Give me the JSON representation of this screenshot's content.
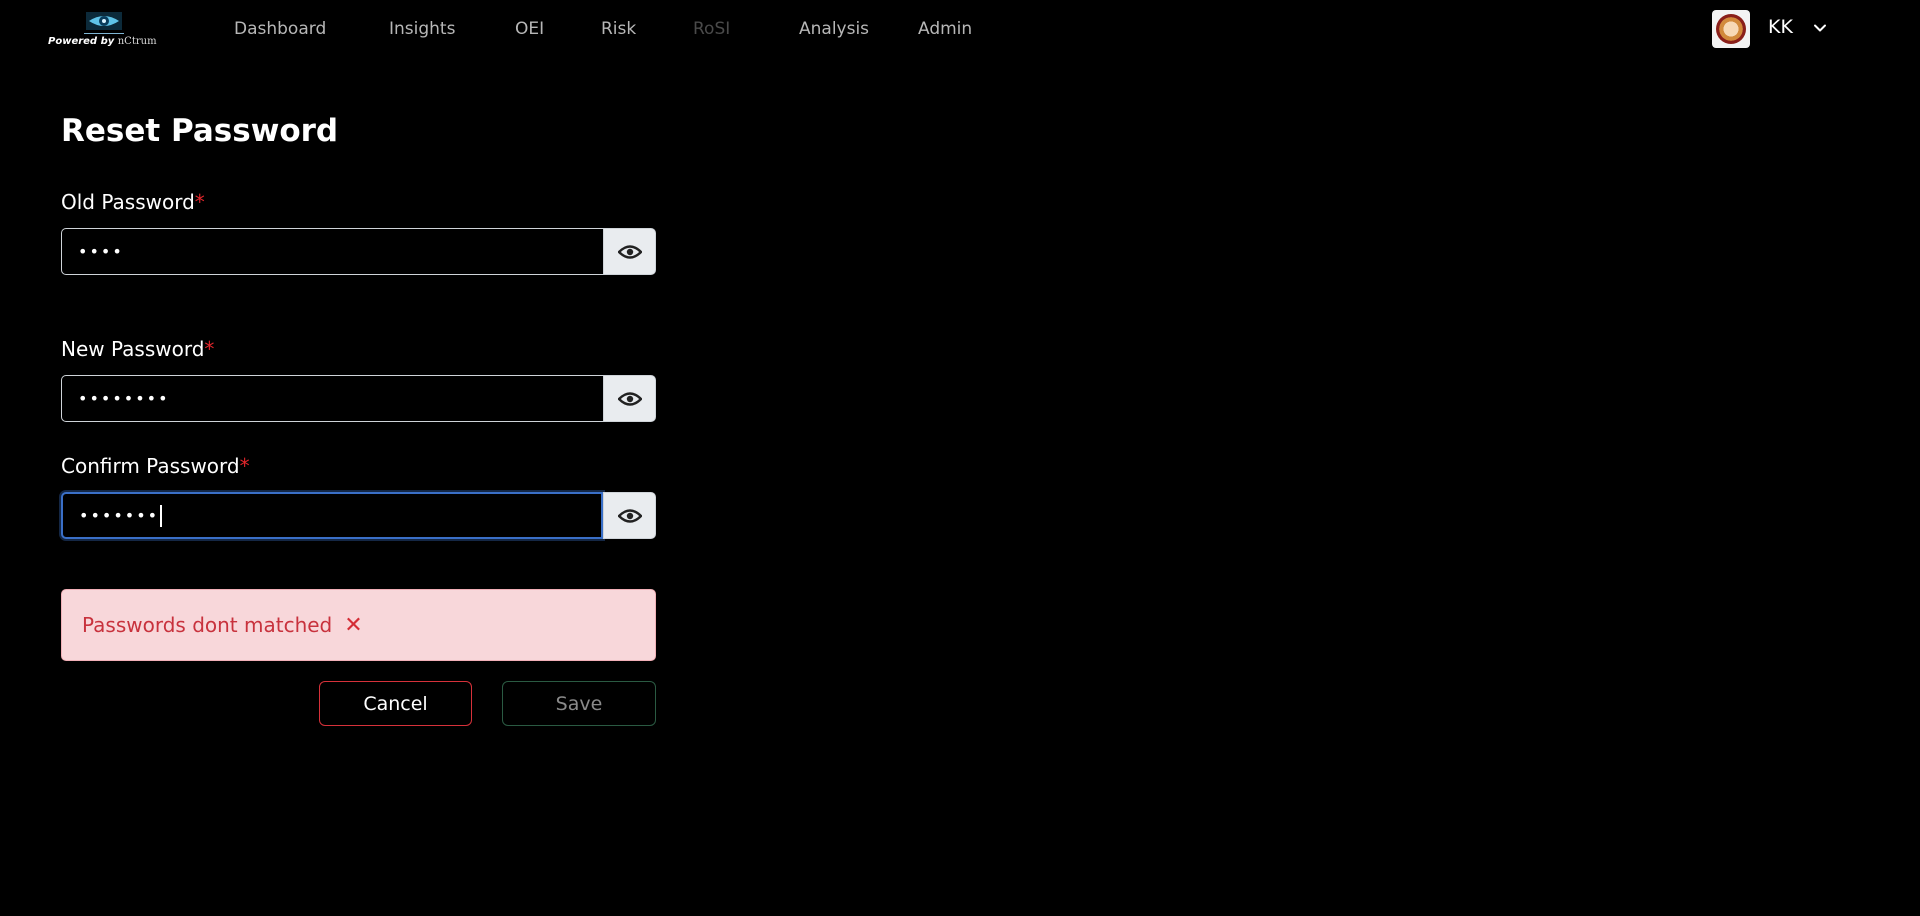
{
  "header": {
    "logo_tagline": "Powered by",
    "logo_brand": "nCtrum",
    "nav": [
      {
        "label": "Dashboard",
        "enabled": true
      },
      {
        "label": "Insights",
        "enabled": true
      },
      {
        "label": "OEI",
        "enabled": true
      },
      {
        "label": "Risk",
        "enabled": true
      },
      {
        "label": "RoSI",
        "enabled": false
      },
      {
        "label": "Analysis",
        "enabled": true
      },
      {
        "label": "Admin",
        "enabled": true
      }
    ],
    "user_initials": "KK",
    "user_menu_icon": "chevron-down-icon"
  },
  "form": {
    "title": "Reset Password",
    "required_marker": "*",
    "old_password": {
      "label": "Old Password",
      "masked_value": "••••",
      "toggle_icon": "eye-icon"
    },
    "new_password": {
      "label": "New Password",
      "masked_value": "••••••••",
      "toggle_icon": "eye-icon"
    },
    "confirm_password": {
      "label": "Confirm Password",
      "masked_value": "•••••••",
      "toggle_icon": "eye-icon",
      "focused": true
    },
    "error_message": "Passwords dont matched",
    "error_close_glyph": "✕",
    "cancel_label": "Cancel",
    "save_label": "Save"
  },
  "colors": {
    "background": "#000000",
    "required": "#e0262b",
    "error_bg": "#f8d7da",
    "error_text": "#c8323d",
    "cancel_border": "#d6313a",
    "focus_border": "#3a6fc7"
  }
}
